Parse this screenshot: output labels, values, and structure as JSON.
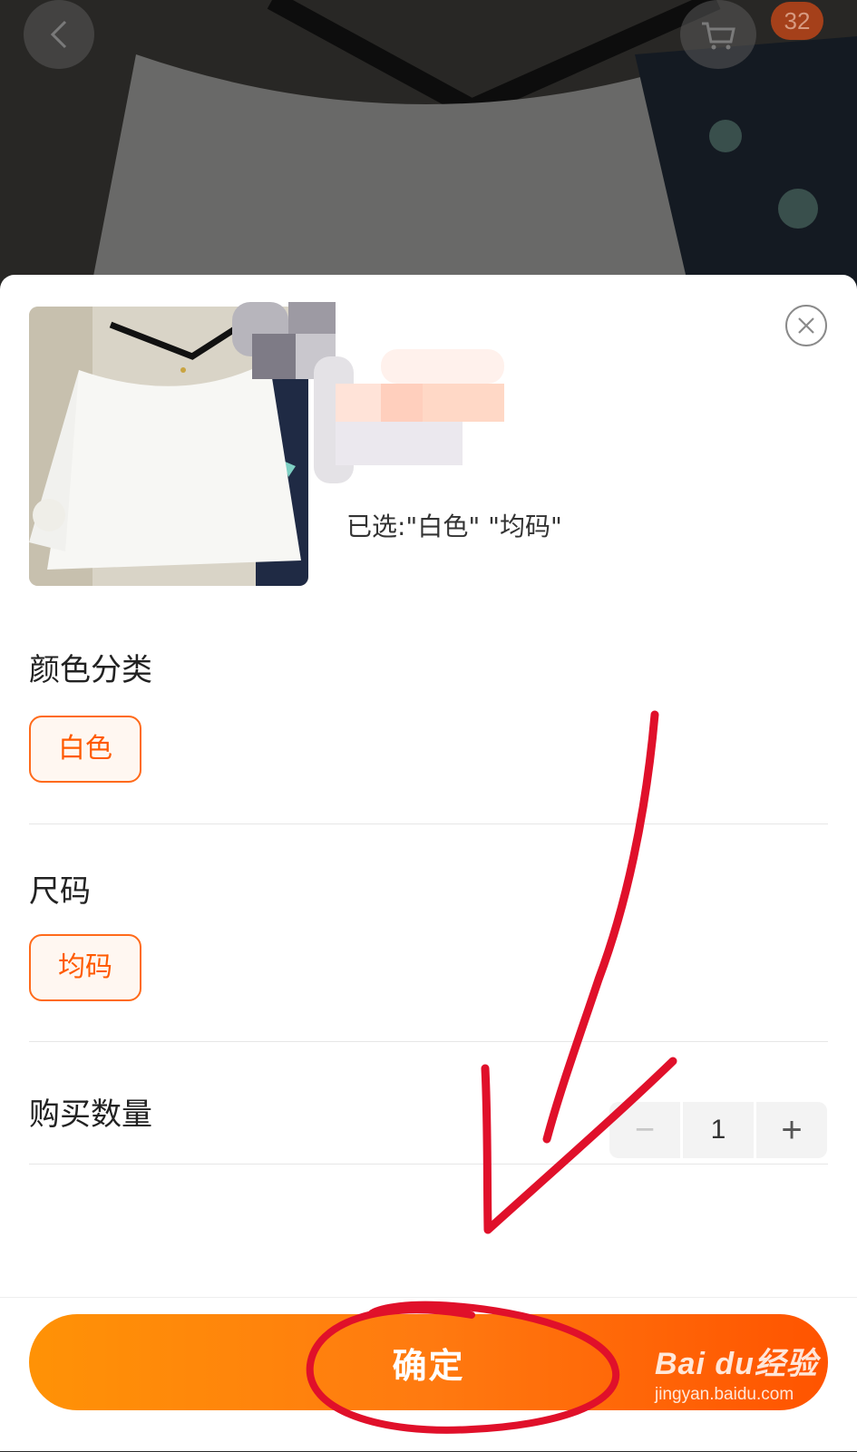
{
  "header": {
    "cart_badge_count": "32",
    "back_icon": "chevron-left-icon",
    "cart_icon": "cart-icon"
  },
  "sku_panel": {
    "selected_text": "已选:\"白色\" \"均码\"",
    "close_icon": "close-circle-icon",
    "color_section": {
      "title": "颜色分类",
      "options": [
        "白色"
      ],
      "selected": "白色"
    },
    "size_section": {
      "title": "尺码",
      "options": [
        "均码"
      ],
      "selected": "均码"
    },
    "quantity": {
      "label": "购买数量",
      "value": "1",
      "minus": "−",
      "plus": "+"
    },
    "confirm_label": "确定"
  },
  "colors": {
    "accent": "#ff5a00",
    "button_gradient_start": "#ff9206",
    "button_gradient_end": "#ff5400",
    "annotation_red": "#e0102a"
  },
  "watermark": {
    "logo": "Bai du经验",
    "url": "jingyan.baidu.com"
  }
}
